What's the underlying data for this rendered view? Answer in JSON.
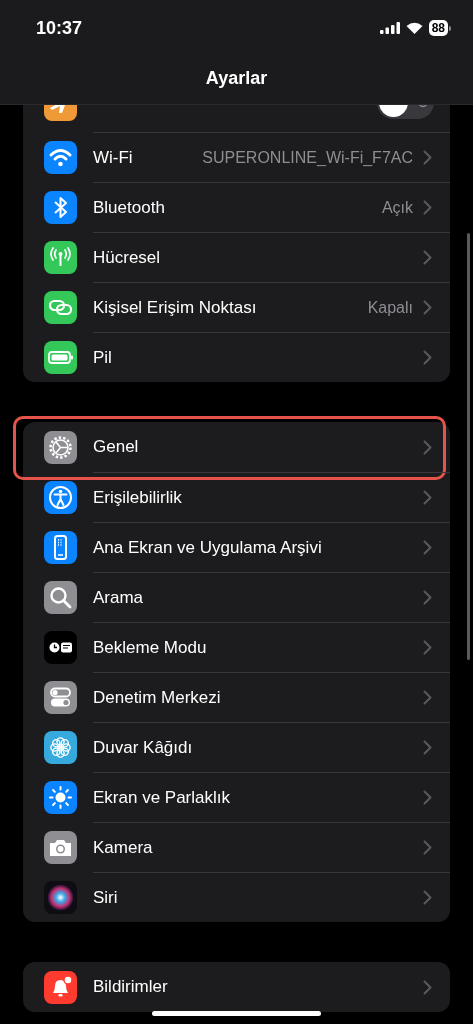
{
  "status_bar": {
    "time": "10:37",
    "battery": "88"
  },
  "title": "Ayarlar",
  "groups": [
    {
      "items": [
        {
          "kind": "toggle",
          "on": false,
          "highlighted": false
        },
        {
          "kind": "link",
          "label": "Wi-Fi",
          "value": "SUPERONLINE_Wi-Fi_F7AC",
          "highlighted": false
        },
        {
          "kind": "link",
          "label": "Bluetooth",
          "value": "Açık",
          "highlighted": false
        },
        {
          "kind": "link",
          "label": "Hücresel",
          "highlighted": false
        },
        {
          "kind": "link",
          "label": "Kişisel Erişim Noktası",
          "value": "Kapalı",
          "highlighted": false
        },
        {
          "kind": "link",
          "label": "Pil",
          "highlighted": false
        }
      ]
    },
    {
      "items": [
        {
          "kind": "link",
          "label": "Genel",
          "highlighted": true
        },
        {
          "kind": "link",
          "label": "Erişilebilirlik",
          "highlighted": false
        },
        {
          "kind": "link",
          "label": "Ana Ekran ve Uygulama Arşivi",
          "highlighted": false
        },
        {
          "kind": "link",
          "label": "Arama",
          "highlighted": false
        },
        {
          "kind": "link",
          "label": "Bekleme Modu",
          "highlighted": false
        },
        {
          "kind": "link",
          "label": "Denetim Merkezi",
          "highlighted": false
        },
        {
          "kind": "link",
          "label": "Duvar Kâğıdı",
          "highlighted": false
        },
        {
          "kind": "link",
          "label": "Ekran ve Parlaklık",
          "highlighted": false
        },
        {
          "kind": "link",
          "label": "Kamera",
          "highlighted": false
        },
        {
          "kind": "link",
          "label": "Siri",
          "highlighted": false
        }
      ]
    },
    {
      "items": [
        {
          "kind": "link",
          "label": "Bildirimler",
          "highlighted": false
        }
      ]
    }
  ]
}
